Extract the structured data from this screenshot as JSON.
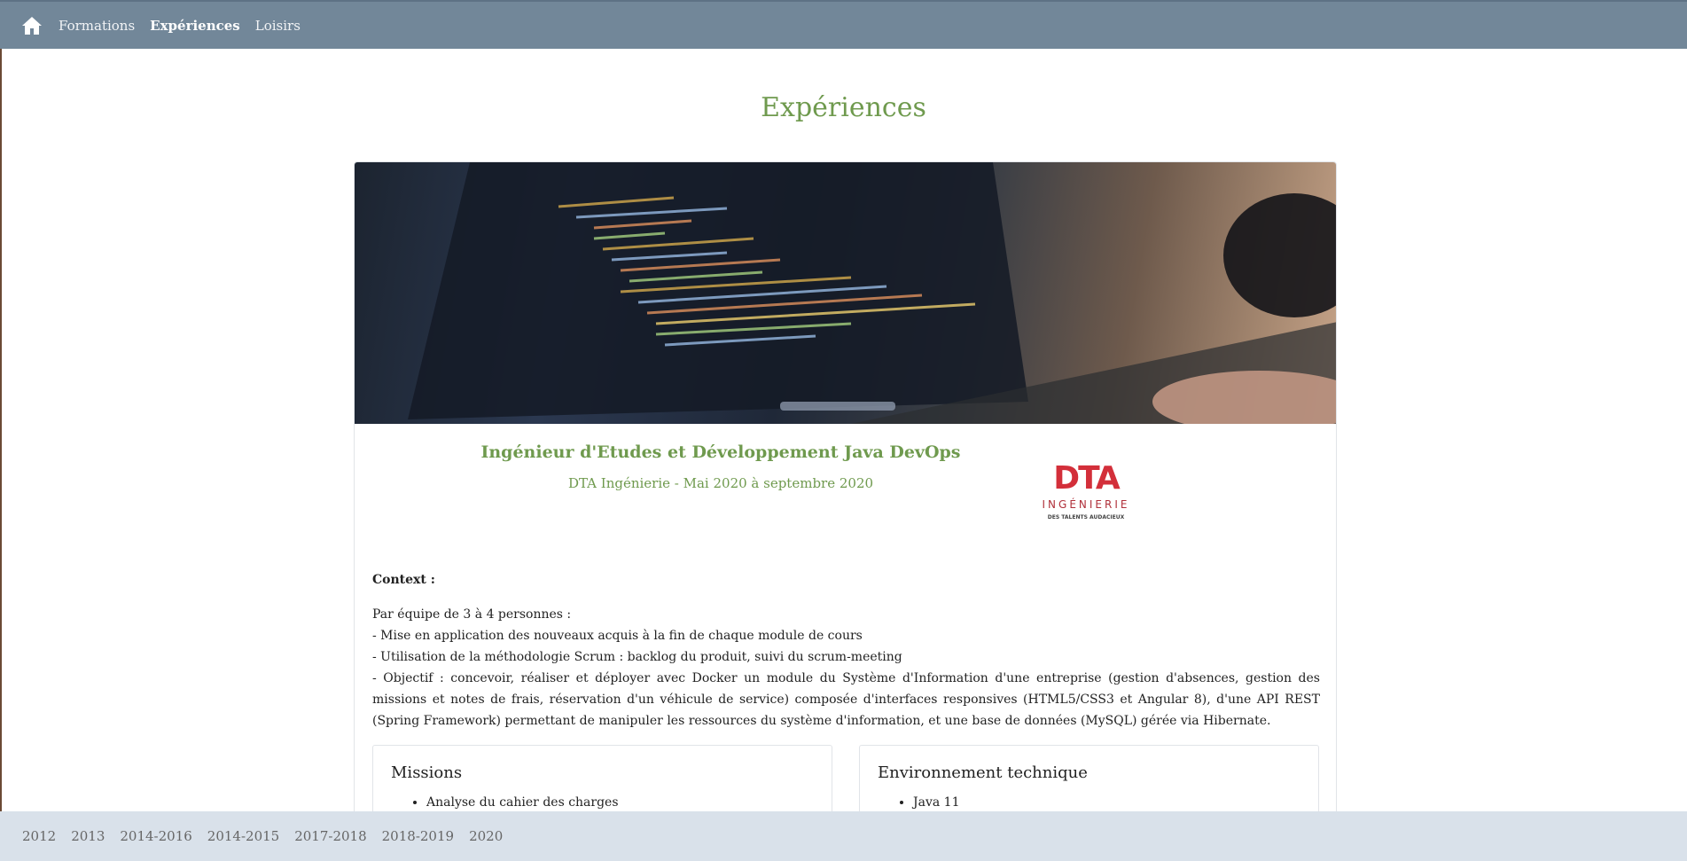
{
  "nav": {
    "home_icon": "home-icon",
    "links": [
      "Formations",
      "Expériences",
      "Loisirs"
    ],
    "active": "Expériences"
  },
  "page": {
    "title": "Expériences"
  },
  "experience": {
    "title": "Ingénieur d'Etudes et Développement Java DevOps",
    "subtitle": "DTA Ingénierie - Mai 2020 à septembre 2020",
    "logo": {
      "mark": "DTA",
      "line": "INGÉNIERIE",
      "tagline": "DES TALENTS AUDACIEUX"
    },
    "context_label": "Context :",
    "context_lines": [
      "Par équipe de 3 à 4 personnes :",
      "- Mise en application des nouveaux acquis à la fin de chaque module de cours",
      "- Utilisation de la méthodologie Scrum : backlog du produit, suivi du scrum-meeting",
      "- Objectif : concevoir, réaliser et déployer avec Docker un module du Système d'Information d'une entreprise (gestion d'absences, gestion des missions et notes de frais, réservation d'un véhicule de service) composée d'interfaces responsives (HTML5/CSS3 et Angular 8), d'une API REST (Spring Framework) permettant de manipuler les ressources du système d'information, et une base de données (MySQL) gérée via Hibernate."
    ],
    "missions": {
      "title": "Missions",
      "items": [
        "Analyse du cahier des charges"
      ]
    },
    "environment": {
      "title": "Environnement technique",
      "items": [
        "Java 11"
      ]
    }
  },
  "years": [
    "2012",
    "2013",
    "2014-2016",
    "2014-2015",
    "2017-2018",
    "2018-2019",
    "2020"
  ],
  "colors": {
    "navbar": "#728799",
    "accent_green": "#6f9a4e",
    "yearbar": "#d9e1ea",
    "logo_red": "#d32f3a"
  }
}
